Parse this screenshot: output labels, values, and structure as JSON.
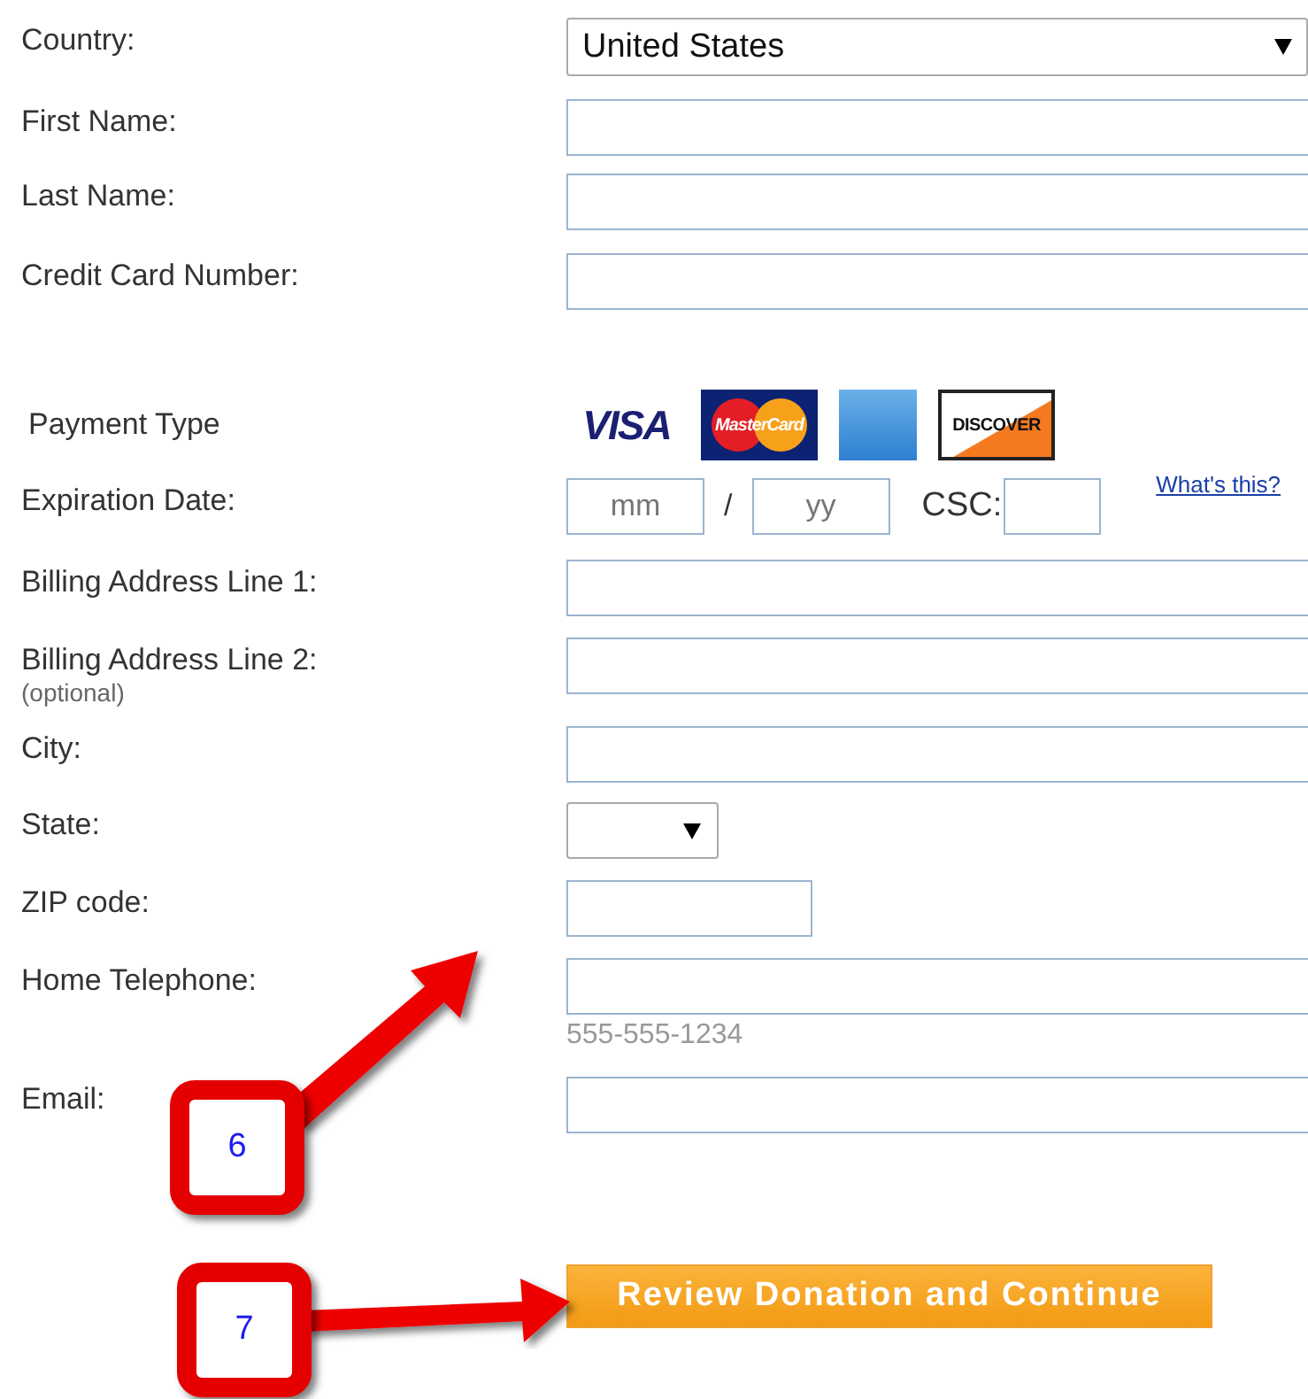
{
  "form": {
    "rows": [
      {
        "kind": "select",
        "label": "Country:",
        "value": "United States"
      },
      {
        "kind": "text",
        "label": "First Name:"
      },
      {
        "kind": "text",
        "label": "Last Name:"
      },
      {
        "kind": "text",
        "label": "Credit Card Number:"
      },
      {
        "kind": "cards",
        "label": "Payment Type",
        "cards": [
          {
            "kind": "visa",
            "label": "VISA"
          },
          {
            "kind": "mastercard",
            "label": "MasterCard"
          },
          {
            "kind": "amex"
          },
          {
            "kind": "discover",
            "label": "DISCOVER"
          }
        ]
      },
      {
        "kind": "expiration",
        "label": "Expiration Date:",
        "month_placeholder": "mm",
        "separator": "/",
        "year_placeholder": "yy",
        "csc_label": "CSC:",
        "help_link": "What's this?"
      },
      {
        "kind": "text",
        "label": "Billing Address Line 1:"
      },
      {
        "kind": "text",
        "label": "Billing Address Line 2:",
        "note": "(optional)"
      },
      {
        "kind": "text",
        "label": "City:"
      },
      {
        "kind": "small-select",
        "label": "State:"
      },
      {
        "kind": "short-text",
        "label": "ZIP code:"
      },
      {
        "kind": "text",
        "label": "Home Telephone:",
        "hint": "555-555-1234"
      },
      {
        "kind": "text",
        "label": "Email:"
      }
    ],
    "submit": "Review Donation and Continue"
  },
  "callouts": [
    {
      "number": "6"
    },
    {
      "number": "7"
    }
  ]
}
